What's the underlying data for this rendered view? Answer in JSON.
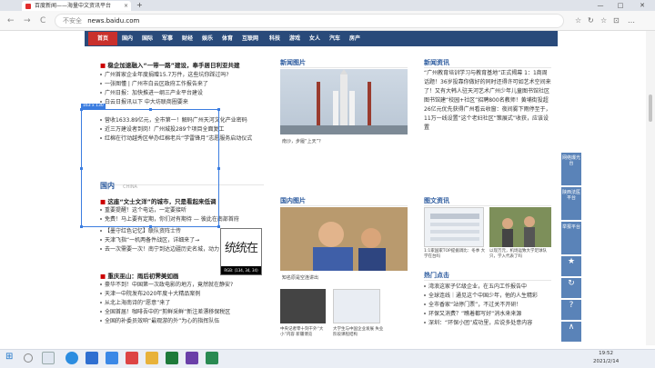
{
  "browser": {
    "tab_title": "百度新闻——海量中文资讯平台",
    "tab_close": "×",
    "new_tab": "+",
    "window_min": "—",
    "window_max": "□",
    "window_close": "✕",
    "back": "←",
    "forward": "→",
    "reload": "C",
    "security_text": "不安全",
    "url": "news.baidu.com",
    "toolbar_icons": [
      "☆",
      "↻",
      "☆",
      "⊡",
      "…"
    ]
  },
  "navbar": {
    "home": "首页",
    "items": [
      "国内",
      "国际",
      "军事",
      "财经",
      "娱乐",
      "体育",
      "互联网",
      "科技",
      "游戏",
      "女人",
      "汽车",
      "房产"
    ]
  },
  "col1": {
    "headline": "稳企加速融入“一带一路”建设，奉手居日利亚共建",
    "items": [
      "广州首家企业年度捐赠15.7万件，这些坑你踩过吗?",
      "一张图懂 | 广州市白云区政府工作报告来了",
      "广州日报：加快推进一纲三产业平台建设",
      "白云日报讯以下 中大坊联商圈要来",
      "营收1633.89亿元，全市第一！解码广州天河文化产业密码",
      "近三万建设者到岗！广州城投289个项目全面复工",
      "红棉在行动越秀区举办红棉老兵“学雷锋月”志愿服务启动仪式"
    ]
  },
  "col2": {
    "title": "新闻图片",
    "caption": "南沙，步履“上天”？"
  },
  "col3": {
    "title": "新闻资讯",
    "text": "“广州教育培训学习与教育基地”正式揭幕 1：1商周话题！36岁投靠你做好的同时还得许可如艺术空间来了！又有大韩人驻天河艺术广州少年儿童图书馆社区图书馆建“校园+社区”招聘800名教师！黄埔街投超26亿元优先获得广州看云收窗：夜间雾下雨停至于，11万一线设置”这个老妇社区“策展式”收获，应该设置"
  },
  "guonei": {
    "title": "国内",
    "en": "CHINA",
    "headline": "这座“文士文洋”的城市，只是看起来低调",
    "items": [
      "重要提醒！这个电话，一定要接听",
      "免费！马上要有定期，你们对有期待 — 彼此在南部首府",
      "【墨守红色记忆】联队资阵士传",
      "天津飞指“一机两备件战区，详细来了→",
      "去一次需要一次！南宁到达边疆历史名城，动力",
      "重庆巫山：雨后初霁美如画",
      "豪华不到！中国第一次政电影的地方，竟然就在静安?",
      "天津一中院发布2020年度十大精品案例",
      "从北上海南诗的“愿意”来了",
      "全国首届！咖啡吾中的“剪鲜采鲜”新注差漂移保税区",
      "全国的补委员效响“最观游的外”为心的指挥队伍"
    ]
  },
  "guonei_pics": {
    "title": "国内图片",
    "caption1": "知名原是空连讲出",
    "caption2": "中央记者零十刻干外“大小”内容 新疆博览",
    "caption3": "大学生与中国企业发展 失业阶段课程结构"
  },
  "tuwen": {
    "title": "图文资讯",
    "caption1": "1:1家国家TOP提据调比：冬季 大学在台吗",
    "caption2": "以现万元，机场运致大学足球队只，学入代表了吗"
  },
  "hot": {
    "title": "热门点击",
    "items": [
      "湾浪这家子亿级企业，在五内工作报告中",
      "全球连线｜通见这个中国少年，他的人生精彩",
      "全市香家“站停门票”，不过关不开研！",
      "环保又消费？”瞧着都写好“消水来来源",
      "深圳：“环保小团”成功里，应说多处意内容"
    ]
  },
  "selection": {
    "size": "163 x 130",
    "magnifier_text": "统统在",
    "rgb": "RGB: (134, 34, 34)"
  },
  "sidebar": [
    "网络爆光台",
    "陕西法医平台",
    "举报平台",
    "★",
    "↻",
    "?",
    "∧"
  ],
  "taskbar": {
    "time": "19:52",
    "date": "2021/2/14"
  }
}
